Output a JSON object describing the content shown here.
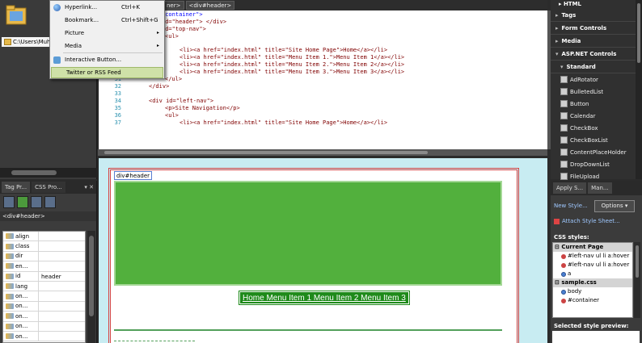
{
  "menu": {
    "items": [
      {
        "label": "Hyperlink...",
        "shortcut": "Ctrl+K",
        "icon": "hyperlink-icon"
      },
      {
        "label": "Bookmark...",
        "shortcut": "Ctrl+Shift+G"
      },
      {
        "label": "Picture",
        "submenu": "▸"
      },
      {
        "label": "Media",
        "submenu": "▸"
      },
      {
        "label": "Interactive Button...",
        "icon": "interactive-button-icon"
      },
      {
        "label": "Twitter or RSS Feed"
      }
    ]
  },
  "left_top": {
    "path": "C:\\Users\\Muha"
  },
  "left_bottom": {
    "tabs": [
      "Tag Pr...",
      "CSS Pro..."
    ],
    "pin_close": "▾ ✕",
    "selected_tag": "<div#header>",
    "attributes": [
      {
        "name": "align",
        "value": ""
      },
      {
        "name": "class",
        "value": ""
      },
      {
        "name": "dir",
        "value": ""
      },
      {
        "name": "en...",
        "value": ""
      },
      {
        "name": "id",
        "value": "header"
      },
      {
        "name": "lang",
        "value": ""
      },
      {
        "name": "on...",
        "value": ""
      },
      {
        "name": "on...",
        "value": ""
      },
      {
        "name": "on...",
        "value": ""
      },
      {
        "name": "on...",
        "value": ""
      },
      {
        "name": "on...",
        "value": ""
      }
    ]
  },
  "breadcrumbs": [
    "ner>",
    "<div#header>"
  ],
  "code": {
    "lines": [
      {
        "num": "",
        "text": "\"container\">"
      },
      {
        "num": "",
        "text": "id=\"header\"> </div>"
      },
      {
        "num": "",
        "text": "id=\"top-nav\">"
      },
      {
        "num": "",
        "text": "<ul>"
      },
      {
        "num": "",
        "text": "<li><a href=\"index.html\" title=\"Site Home Page\">Home</a></li>"
      },
      {
        "num": "",
        "text": "<li><a href=\"index.html\" title=\"Menu Item 1.\">Menu Item 1</a></li>"
      },
      {
        "num": "",
        "text": "<li><a href=\"index.html\" title=\"Menu Item 2.\">Menu Item 2</a></li>"
      },
      {
        "num": "",
        "text": "<li><a href=\"index.html\" title=\"Menu Item 3.\">Menu Item 3</a></li>"
      },
      {
        "num": "31",
        "text": "</ul>"
      },
      {
        "num": "32",
        "text": "</div>"
      },
      {
        "num": "33",
        "text": ""
      },
      {
        "num": "34",
        "text": "<div id=\"left-nav\">"
      },
      {
        "num": "35",
        "text": "<p>Site Navigation</p>"
      },
      {
        "num": "36",
        "text": "<ul>"
      },
      {
        "num": "37",
        "text": "<li><a href=\"index.html\" title=\"Site Home Page\">Home</a></li>"
      }
    ]
  },
  "design": {
    "label": "div#header",
    "nav_text": "Home Menu Item 1 Menu Item 2 Menu Item 3"
  },
  "toolbox": {
    "head": "HTML",
    "categories": [
      "Tags",
      "Form Controls",
      "Media",
      "ASP.NET Controls",
      "Standard"
    ],
    "items": [
      "AdRotator",
      "BulletedList",
      "Button",
      "Calendar",
      "CheckBox",
      "CheckBoxList",
      "ContentPlaceHolder",
      "DropDownList",
      "FileUpload"
    ]
  },
  "styles_panel": {
    "tabs": [
      "Apply S...",
      "Man..."
    ],
    "new_style": "New Style...",
    "options": "Options ▾",
    "attach": "Attach Style Sheet...",
    "css_styles_label": "CSS styles:",
    "current_page": "Current Page",
    "current_items": [
      "#left-nav ul li a:hover",
      "#left-nav ul li a:hover",
      "a"
    ],
    "sheet": "sample.css",
    "sheet_items": [
      "body",
      "#container"
    ],
    "preview_label": "Selected style preview:"
  },
  "colors": {
    "header_green": "#52b03d",
    "nav_green": "#1e8a1a",
    "design_bg": "#c8ecf2",
    "menu_highlight": "#cfe1a8"
  }
}
